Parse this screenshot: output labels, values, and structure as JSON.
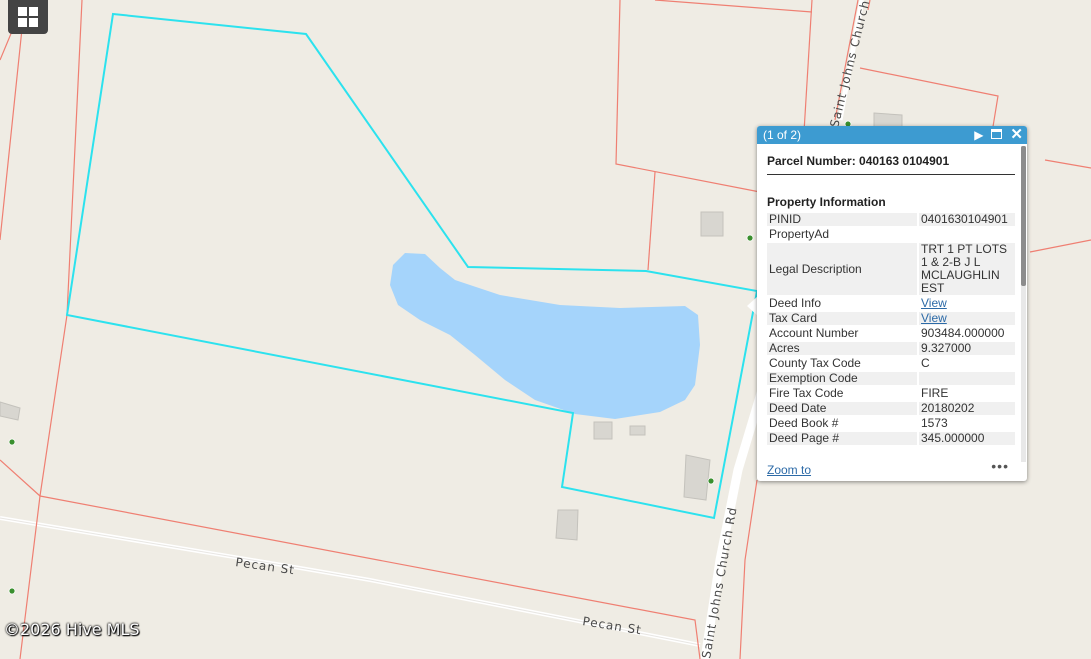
{
  "map": {
    "roads": [
      {
        "name": "Pecan St"
      },
      {
        "name": "Pecan St"
      },
      {
        "name": "Saint Johns Church Rd"
      },
      {
        "name": "Saint Johns Church Rd"
      }
    ],
    "colors": {
      "parcel_line": "#ef7f72",
      "selected_parcel": "#2ce2ee",
      "water": "#a5d4fb",
      "background": "#efece4",
      "building": "#d8d6d0"
    },
    "copyright": "©2026 Hive MLS",
    "basemap_icon": "grid-icon"
  },
  "popup": {
    "pager": "(1 of 2)",
    "icons": [
      "next-icon",
      "maximize-icon",
      "close-icon"
    ],
    "title": "Parcel Number: 040163 0104901",
    "section": "Property Information",
    "rows": [
      {
        "label": "PINID",
        "value": "0401630104901"
      },
      {
        "label": "PropertyAd",
        "value": ""
      },
      {
        "label": "Legal Description",
        "value": "TRT 1 PT LOTS 1 & 2-B J L MCLAUGHLIN EST"
      },
      {
        "label": "Deed Info",
        "value": "View"
      },
      {
        "label": "Tax Card",
        "value": "View"
      },
      {
        "label": "Account Number",
        "value": "903484.000000"
      },
      {
        "label": "Acres",
        "value": "9.327000"
      },
      {
        "label": "County Tax Code",
        "value": "C"
      },
      {
        "label": "Exemption Code",
        "value": ""
      },
      {
        "label": "Fire Tax Code",
        "value": "FIRE"
      },
      {
        "label": "Deed Date",
        "value": "20180202"
      },
      {
        "label": "Deed Book #",
        "value": "1573"
      },
      {
        "label": "Deed Page #",
        "value": "345.000000"
      }
    ],
    "zoom_link": "Zoom to",
    "more": "•••"
  }
}
